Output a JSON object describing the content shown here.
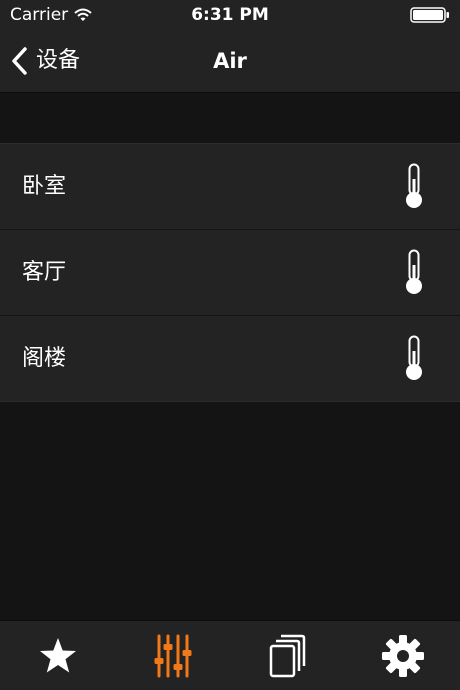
{
  "status_bar": {
    "carrier": "Carrier",
    "time": "6:31 PM",
    "wifi_icon": "wifi-icon",
    "battery_icon": "battery-icon"
  },
  "nav_bar": {
    "back_label": "设备",
    "back_icon": "chevron-left-icon",
    "title": "Air"
  },
  "devices": [
    {
      "label": "卧室",
      "icon": "thermometer-icon"
    },
    {
      "label": "客厅",
      "icon": "thermometer-icon"
    },
    {
      "label": "阁楼",
      "icon": "thermometer-icon"
    }
  ],
  "tab_bar": {
    "items": [
      {
        "icon": "star-icon",
        "active": false
      },
      {
        "icon": "sliders-icon",
        "active": true
      },
      {
        "icon": "pages-icon",
        "active": false
      },
      {
        "icon": "gear-icon",
        "active": false
      }
    ]
  },
  "colors": {
    "background": "#141414",
    "bar": "#232323",
    "row": "#232323",
    "text": "#ffffff",
    "accent": "#f07a1a"
  }
}
